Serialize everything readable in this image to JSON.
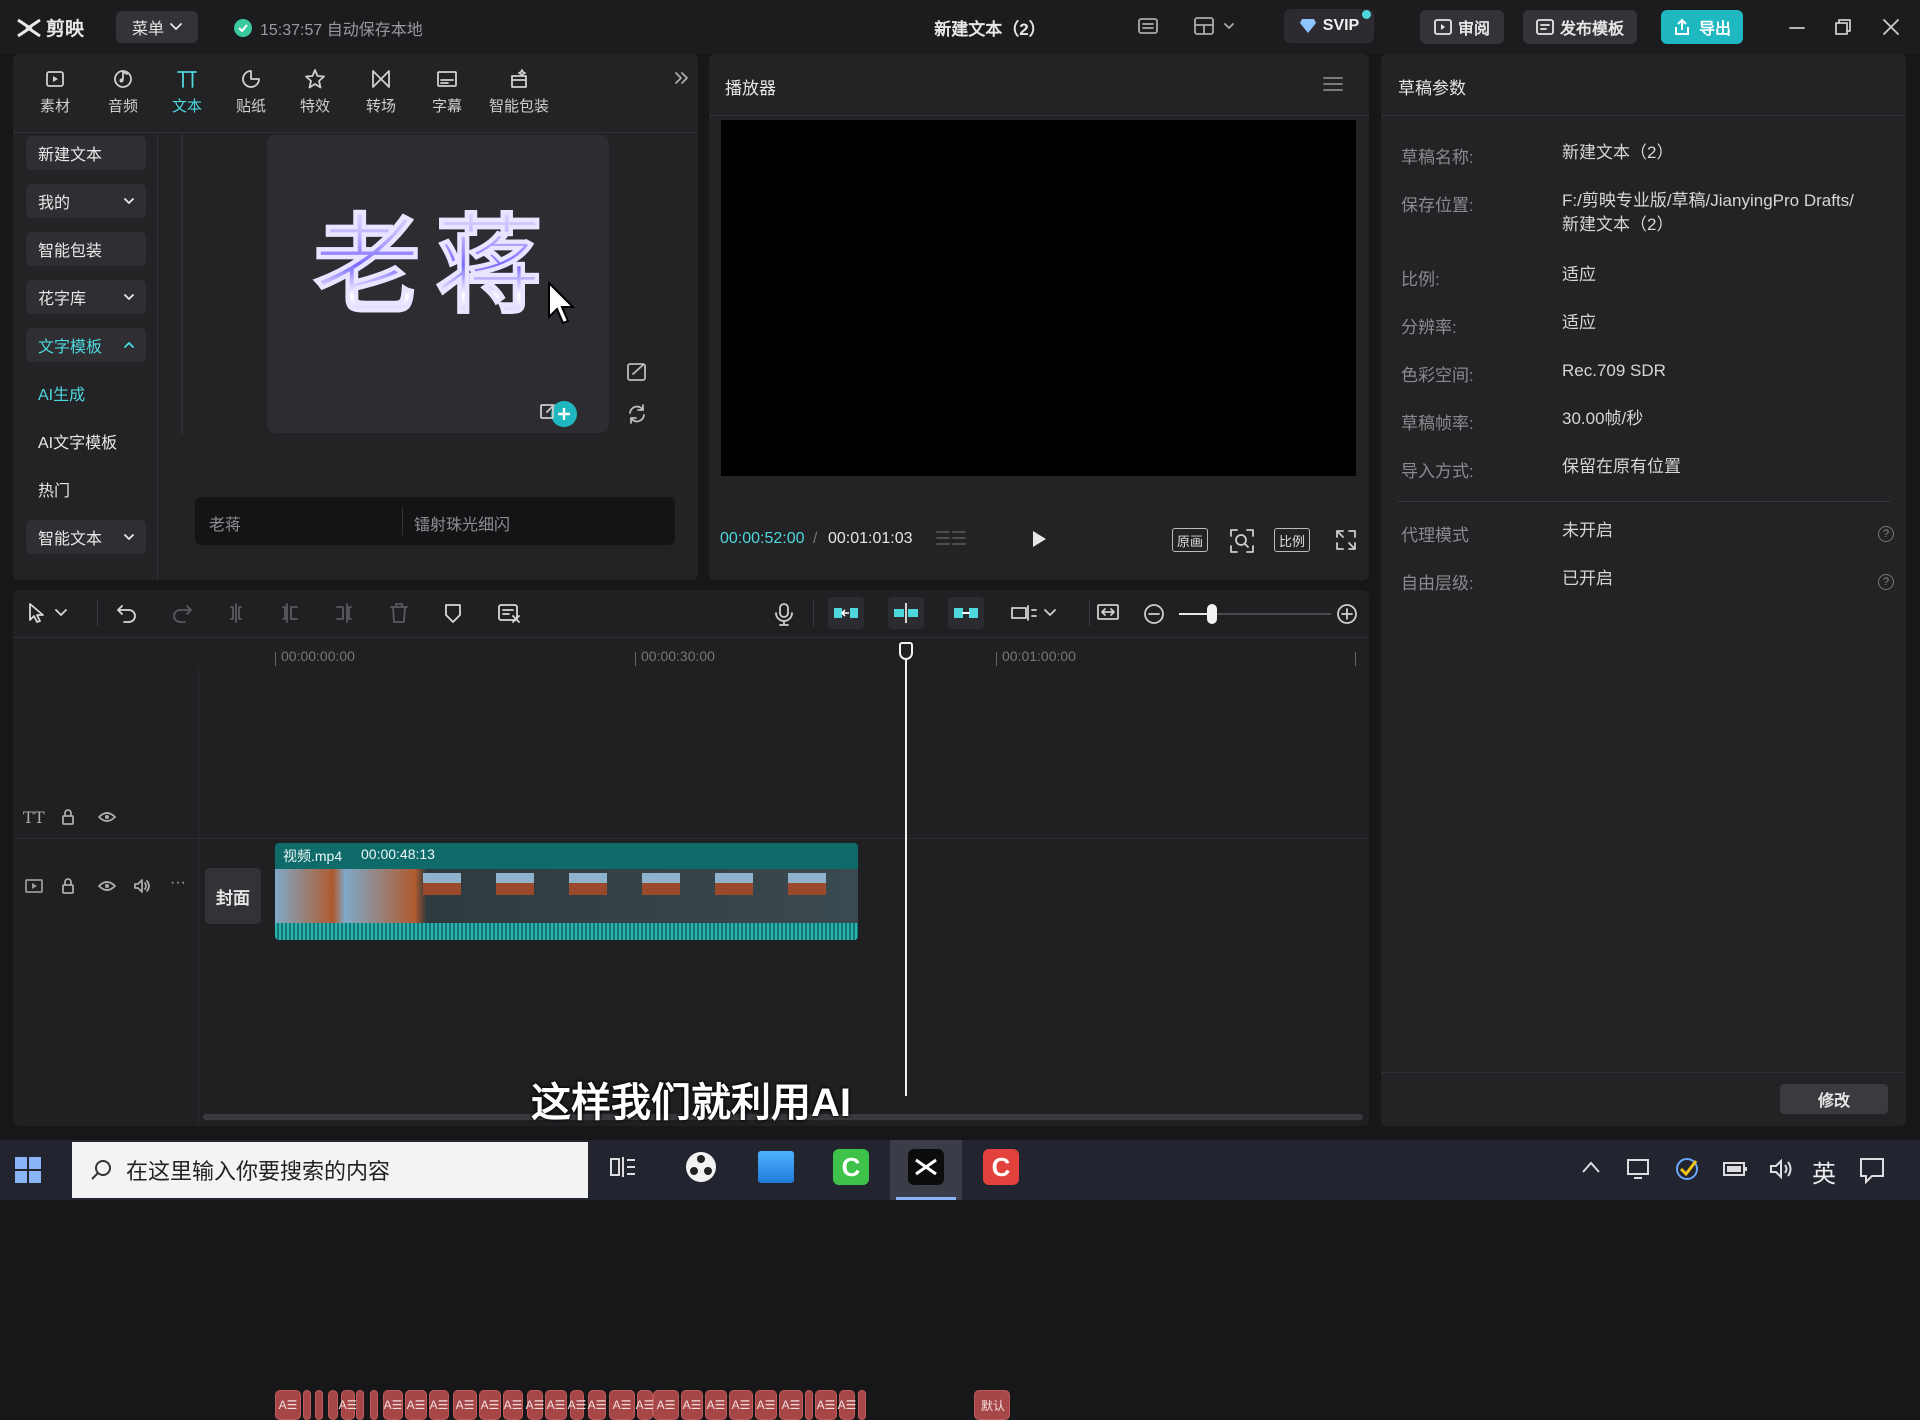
{
  "app": {
    "logo": "剪映",
    "menu_label": "菜单",
    "autosave": "15:37:57 自动保存本地",
    "title": "新建文本（2）",
    "svip": "SVIP",
    "review": "审阅",
    "publish_template": "发布模板",
    "export": "导出"
  },
  "categories": [
    {
      "label": "素材",
      "icon": "media-icon"
    },
    {
      "label": "音频",
      "icon": "audio-icon"
    },
    {
      "label": "文本",
      "icon": "text-icon"
    },
    {
      "label": "贴纸",
      "icon": "sticker-icon"
    },
    {
      "label": "特效",
      "icon": "effects-icon"
    },
    {
      "label": "转场",
      "icon": "transition-icon"
    },
    {
      "label": "字幕",
      "icon": "subtitle-icon"
    },
    {
      "label": "智能包装",
      "icon": "smart-pack-icon"
    }
  ],
  "sidebar": [
    {
      "label": "新建文本"
    },
    {
      "label": "我的"
    },
    {
      "label": "智能包装"
    },
    {
      "label": "花字库"
    },
    {
      "label": "文字模板"
    },
    {
      "label": "AI生成"
    },
    {
      "label": "AI文字模板"
    },
    {
      "label": "热门"
    },
    {
      "label": "智能文本"
    }
  ],
  "preview": {
    "art_text": "老蒋",
    "name": "老蒋",
    "style": "镭射珠光细闪"
  },
  "player": {
    "title": "播放器",
    "current_time": "00:00:52:00",
    "total_time": "00:01:01:03",
    "original_label": "原画",
    "ratio_label": "比例"
  },
  "draft": {
    "title": "草稿参数",
    "rows": [
      {
        "label": "草稿名称:",
        "value": "新建文本（2）"
      },
      {
        "label": "保存位置:",
        "value": "F:/剪映专业版/草稿/JianyingPro Drafts/",
        "value2": "新建文本（2）"
      },
      {
        "label": "比例:",
        "value": "适应"
      },
      {
        "label": "分辨率:",
        "value": "适应"
      },
      {
        "label": "色彩空间:",
        "value": "Rec.709 SDR"
      },
      {
        "label": "草稿帧率:",
        "value": "30.00帧/秒"
      },
      {
        "label": "导入方式:",
        "value": "保留在原有位置"
      },
      {
        "label": "代理模式",
        "value": "未开启"
      },
      {
        "label": "自由层级:",
        "value": "已开启"
      }
    ],
    "modify": "修改"
  },
  "timeline": {
    "ruler": [
      "00:00:00:00",
      "00:00:30:00",
      "00:01:00:00"
    ],
    "cover_label": "封面",
    "video_clip": {
      "name": "视频.mp4",
      "duration": "00:00:48:13"
    },
    "text_clip_glyph": "A☰",
    "default_clip": "默认",
    "subtitle": "这样我们就利用AI"
  },
  "taskbar": {
    "search_placeholder": "在这里输入你要搜索的内容",
    "ime": "英"
  },
  "colors": {
    "accent": "#4dd8dd",
    "export_bg": "#1fb8c0",
    "text_clip": "#a64646",
    "video_clip": "#0f6b6a"
  }
}
